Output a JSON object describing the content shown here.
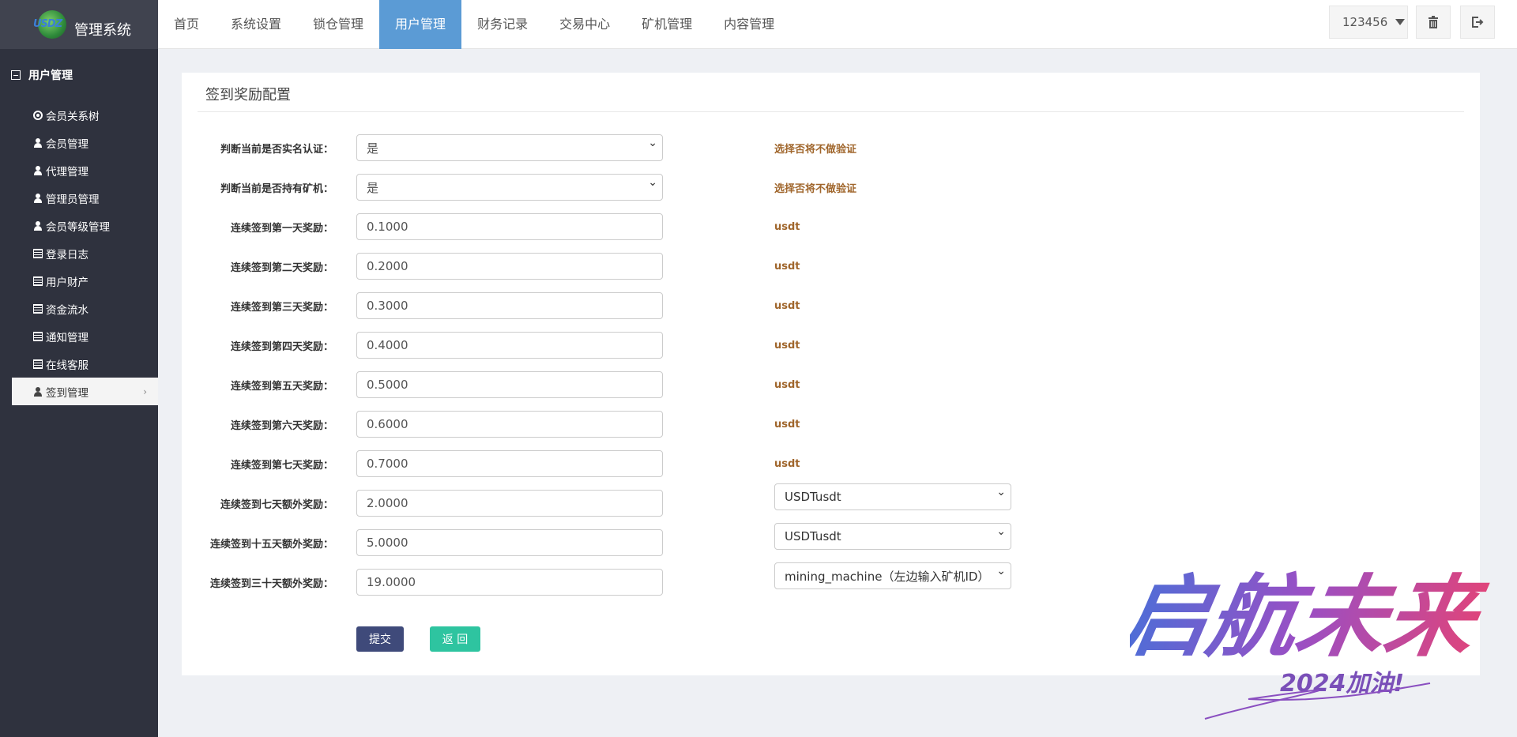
{
  "app": {
    "logo_text": "USDZ",
    "title": "管理系统"
  },
  "topbar": {
    "tabs": [
      {
        "label": "首页",
        "active": false
      },
      {
        "label": "系统设置",
        "active": false
      },
      {
        "label": "锁仓管理",
        "active": false
      },
      {
        "label": "用户管理",
        "active": true
      },
      {
        "label": "财务记录",
        "active": false
      },
      {
        "label": "交易中心",
        "active": false
      },
      {
        "label": "矿机管理",
        "active": false
      },
      {
        "label": "内容管理",
        "active": false
      }
    ],
    "user": "123456",
    "trash_icon": "trash-icon",
    "logout_icon": "logout-icon"
  },
  "sidebar": {
    "group_label": "用户管理",
    "items": [
      {
        "label": "会员关系树",
        "icon": "target-icon"
      },
      {
        "label": "会员管理",
        "icon": "user-icon"
      },
      {
        "label": "代理管理",
        "icon": "user-icon"
      },
      {
        "label": "管理员管理",
        "icon": "user-icon"
      },
      {
        "label": "会员等级管理",
        "icon": "user-icon"
      },
      {
        "label": "登录日志",
        "icon": "list-icon"
      },
      {
        "label": "用户财产",
        "icon": "list-icon"
      },
      {
        "label": "资金流水",
        "icon": "list-icon"
      },
      {
        "label": "通知管理",
        "icon": "list-icon"
      },
      {
        "label": "在线客服",
        "icon": "list-icon"
      },
      {
        "label": "签到管理",
        "icon": "user-icon",
        "active": true
      }
    ]
  },
  "form": {
    "title": "签到奖励配置",
    "rows": [
      {
        "label": "判断当前是否实名认证：",
        "value": "是",
        "type": "select",
        "hint": "选择否将不做验证"
      },
      {
        "label": "判断当前是否持有矿机：",
        "value": "是",
        "type": "select",
        "hint": "选择否将不做验证"
      },
      {
        "label": "连续签到第一天奖励：",
        "value": "0.1000",
        "type": "input",
        "hint": "usdt"
      },
      {
        "label": "连续签到第二天奖励：",
        "value": "0.2000",
        "type": "input",
        "hint": "usdt"
      },
      {
        "label": "连续签到第三天奖励：",
        "value": "0.3000",
        "type": "input",
        "hint": "usdt"
      },
      {
        "label": "连续签到第四天奖励：",
        "value": "0.4000",
        "type": "input",
        "hint": "usdt"
      },
      {
        "label": "连续签到第五天奖励：",
        "value": "0.5000",
        "type": "input",
        "hint": "usdt"
      },
      {
        "label": "连续签到第六天奖励：",
        "value": "0.6000",
        "type": "input",
        "hint": "usdt"
      },
      {
        "label": "连续签到第七天奖励：",
        "value": "0.7000",
        "type": "input",
        "hint": "usdt"
      },
      {
        "label": "连续签到七天额外奖励：",
        "value": "2.0000",
        "type": "input",
        "extra_select": "USDTusdt"
      },
      {
        "label": "连续签到十五天额外奖励：",
        "value": "5.0000",
        "type": "input",
        "extra_select": "USDTusdt"
      },
      {
        "label": "连续签到三十天额外奖励：",
        "value": "19.0000",
        "type": "input",
        "extra_select": "mining_machine（左边输入矿机ID）"
      }
    ],
    "submit_label": "提交",
    "back_label": "返 回"
  },
  "watermark": {
    "main": "启航未来",
    "sub": "2024加油!"
  },
  "colors": {
    "sidebar": "#2f323e",
    "accent": "#5b9bd5",
    "hint": "#a0662c",
    "submit": "#3f4a7a",
    "back": "#2ec4a0"
  }
}
